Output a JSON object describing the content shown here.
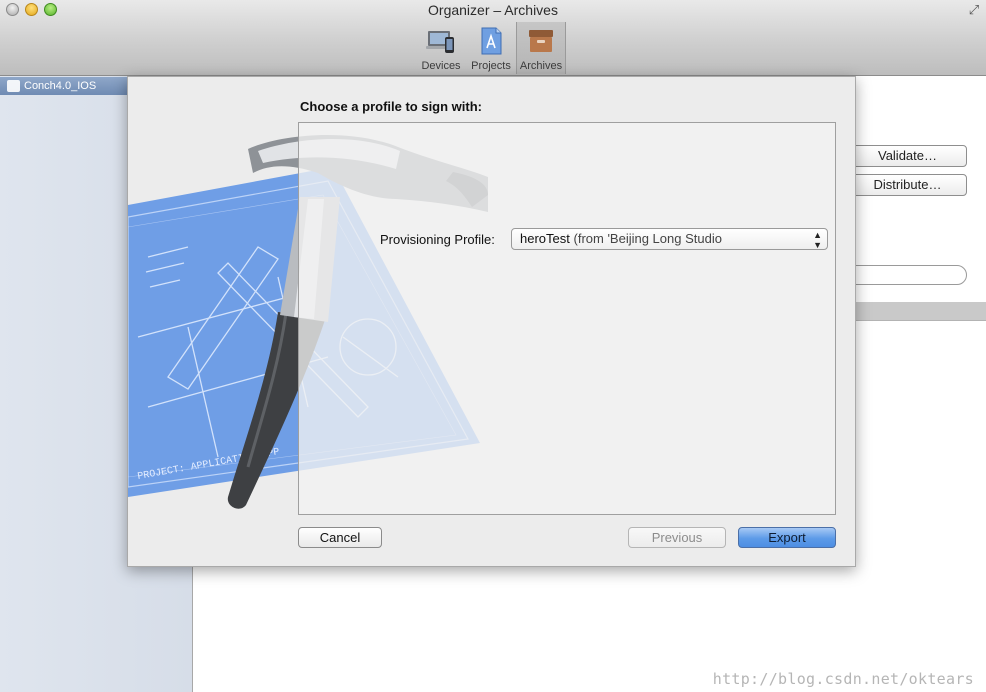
{
  "window": {
    "title": "Organizer – Archives",
    "controls": [
      "close",
      "minimize",
      "zoom"
    ]
  },
  "toolbar": {
    "items": [
      {
        "label": "Devices",
        "icon": "devices-icon",
        "selected": false
      },
      {
        "label": "Projects",
        "icon": "projects-icon",
        "selected": false
      },
      {
        "label": "Archives",
        "icon": "archives-icon",
        "selected": true
      }
    ]
  },
  "sidebar": {
    "items": [
      {
        "label": "Conch4.0_IOS",
        "selected": true
      }
    ]
  },
  "main": {
    "buttons": {
      "validate": "Validate…",
      "distribute": "Distribute…"
    }
  },
  "sheet": {
    "heading": "Choose a profile to sign with:",
    "provisioning_profile": {
      "label": "Provisioning Profile:",
      "value_main": "heroTest",
      "value_muted": "(from 'Beijing Long Studio"
    },
    "buttons": {
      "cancel": "Cancel",
      "previous": "Previous",
      "export": "Export"
    },
    "colors": {
      "primary_button": "#5d9be8",
      "blueprint": "#6f9ee6"
    }
  },
  "watermark": "http://blog.csdn.net/oktears"
}
